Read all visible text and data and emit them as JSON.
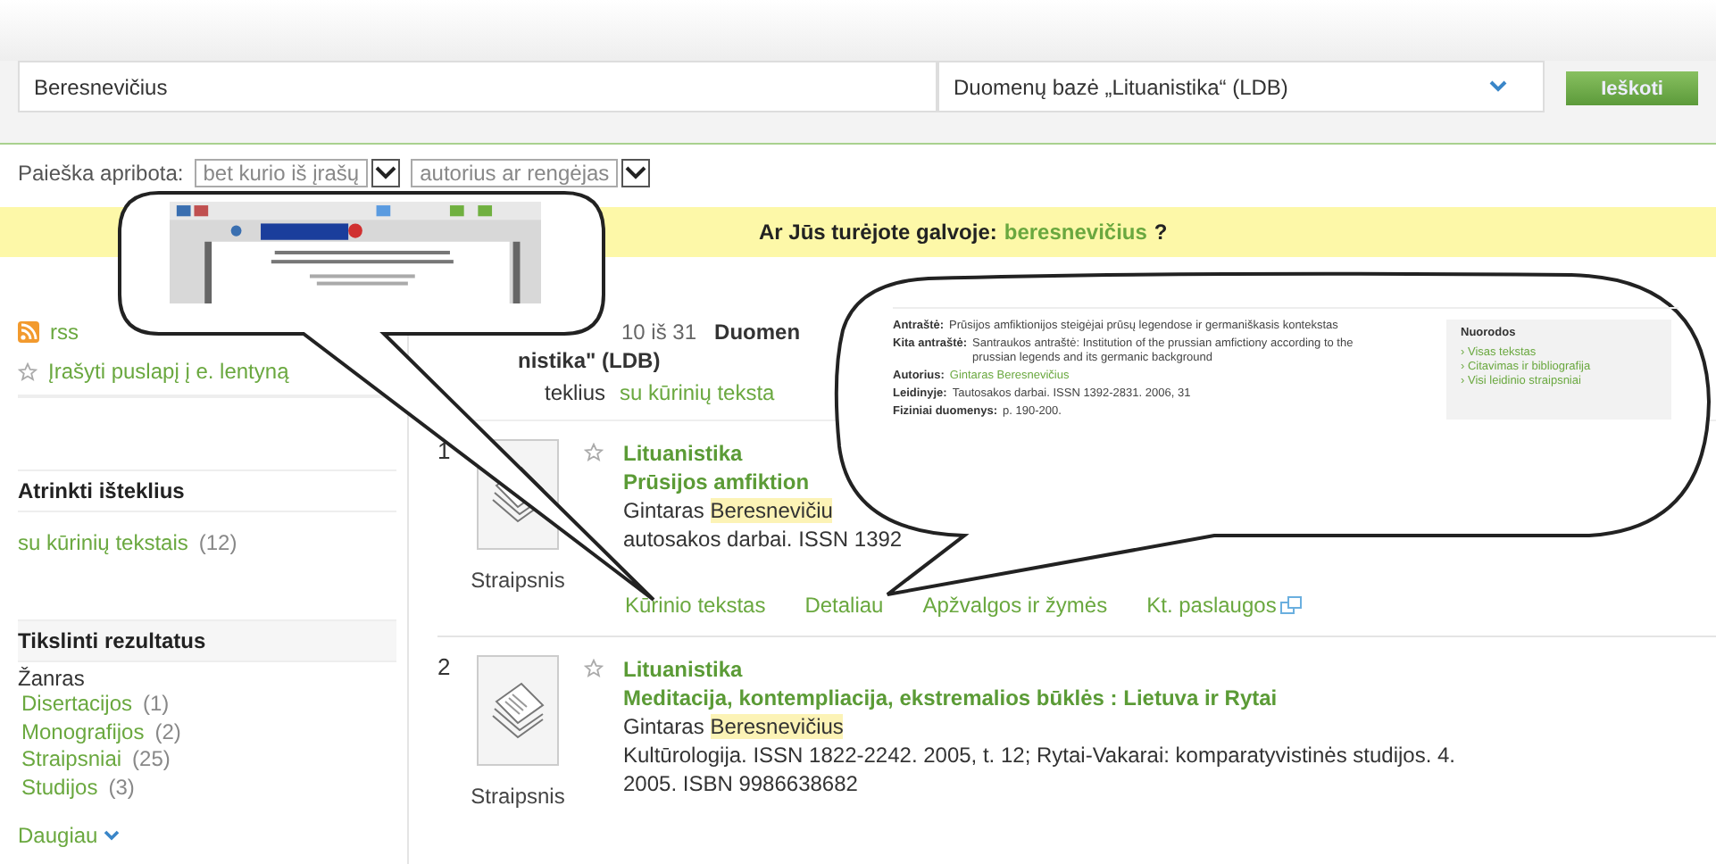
{
  "search": {
    "value": "Beresnevičius",
    "database": "Duomenų bazė „Lituanistika“ (LDB)",
    "button": "Ieškoti"
  },
  "limit": {
    "label": "Paieška apribota:",
    "field": "bet kurio iš įrašų",
    "role": "autorius ar rengėjas"
  },
  "suggestion": {
    "text": "Ar Jūs turėjote galvoje:",
    "link": "beresnevičius",
    "end": "?"
  },
  "sidebar": {
    "rss": "rss",
    "save": "Įrašyti puslapį į e. lentyną",
    "select_title": "Atrinkti išteklius",
    "select_items": [
      {
        "label": "su kūrinių tekstais",
        "count": "(12)"
      }
    ],
    "refine_title": "Tikslinti rezultatus",
    "facet": "Žanras",
    "facet_items": [
      {
        "label": "Disertacijos",
        "count": "(1)"
      },
      {
        "label": "Monografijos",
        "count": "(2)"
      },
      {
        "label": "Straipsniai",
        "count": "(25)"
      },
      {
        "label": "Studijos",
        "count": "(3)"
      }
    ],
    "more": "Daugiau"
  },
  "results": {
    "summary_count": "10 iš 31",
    "summary_db": "Duomen",
    "summary_db2": "nistika\" (LDB)",
    "filter_label": "teklius",
    "filter_link": "su kūrinių teksta",
    "items": [
      {
        "number": "1",
        "type": "Straipsnis",
        "collection": "Lituanistika",
        "title": "Prūsijos amfiktion",
        "author": "Gintaras",
        "author_hl": "Beresnevičiu",
        "source": [
          "autosakos darbai. ISSN 1392"
        ],
        "links": [
          {
            "label": "Kūrinio tekstas",
            "external": false
          },
          {
            "label": "Detaliau",
            "external": false
          },
          {
            "label": "Apžvalgos ir žymės",
            "external": false
          },
          {
            "label": "Kt. paslaugos",
            "external": true
          }
        ]
      },
      {
        "number": "2",
        "type": "Straipsnis",
        "collection": "Lituanistika",
        "title": "Meditacija, kontempliacija, ekstremalios būklės : Lietuva ir Rytai",
        "author": "Gintaras",
        "author_hl": "Beresnevičius",
        "source": [
          "Kultūrologija. ISSN 1822-2242. 2005, t. 12; Rytai-Vakarai: komparatyvistinės studijos. 4.",
          "2005. ISBN 9986638682"
        ]
      }
    ]
  },
  "callouts": [
    {
      "kind": "picture"
    },
    {
      "kind": "record",
      "fields": [
        {
          "label": "Antraštė:",
          "value": "Prūsijos amfiktionijos steigėjai prūsų legendose ir germaniškasis kontekstas",
          "link": false
        },
        {
          "label": "Kita antraštė:",
          "value": "Santraukos antraštė: Institution of the prussian amfictiony according to the prussian legends and its germanic background",
          "link": false
        },
        {
          "label": "Autorius:",
          "value": "Gintaras Beresnevičius",
          "link": true
        },
        {
          "label": "Leidinyje:",
          "value": "Tautosakos darbai. ISSN 1392-2831. 2006, 31",
          "link": false
        },
        {
          "label": "Fiziniai duomenys:",
          "value": "p. 190-200.",
          "link": false
        }
      ],
      "side_title": "Nuorodos",
      "side_links": [
        "› Visas tekstas",
        "› Citavimas ir bibliografija",
        "› Visi leidinio straipsniai"
      ]
    }
  ]
}
